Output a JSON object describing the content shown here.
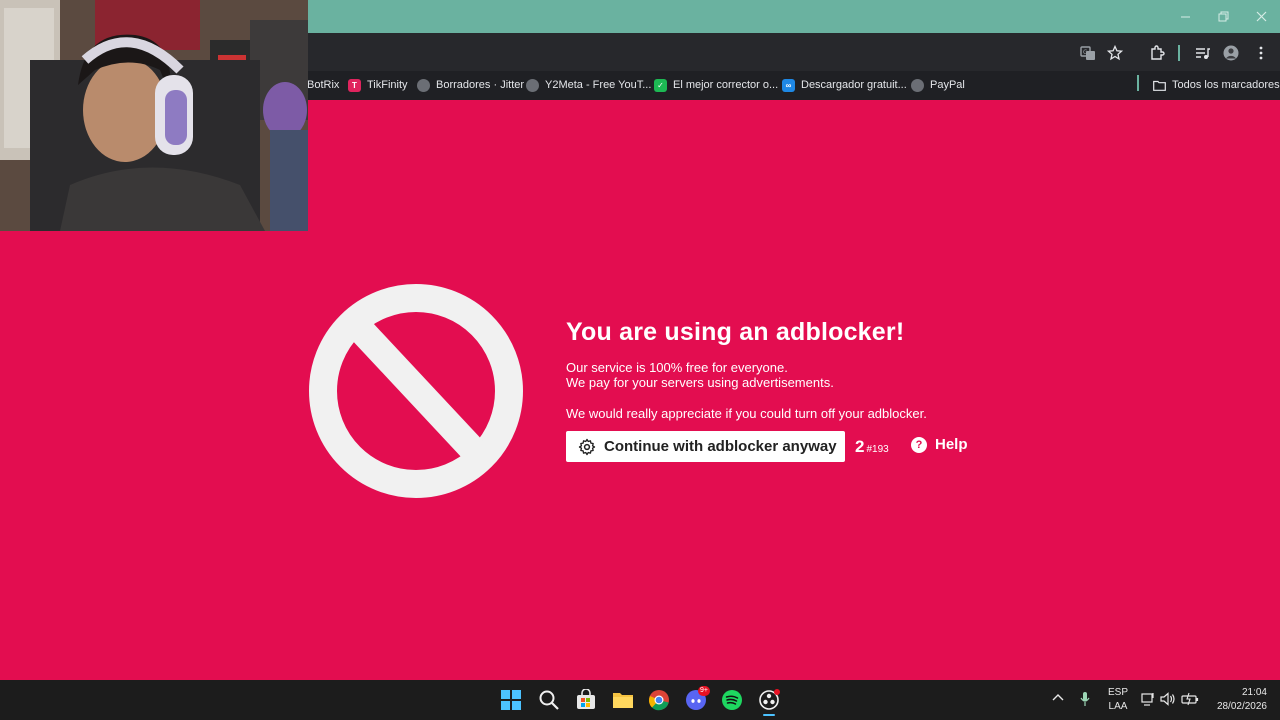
{
  "browser": {
    "bookmarks": [
      {
        "label": "BotRix",
        "favicon_color": "#2a2a2a"
      },
      {
        "label": "TikFinity",
        "favicon_color": "#e0245e"
      },
      {
        "label": "Borradores · Jitter",
        "favicon_color": "#6b6e75"
      },
      {
        "label": "Y2Meta - Free YouT...",
        "favicon_color": "#6b6e75"
      },
      {
        "label": "El mejor corrector o...",
        "favicon_color": "#1db954"
      },
      {
        "label": "Descargador gratuit...",
        "favicon_color": "#1e88e5"
      },
      {
        "label": "PayPal",
        "favicon_color": "#6b6e75"
      }
    ],
    "all_bookmarks_label": "Todos los marcadores"
  },
  "page": {
    "background_color": "#e30d50",
    "headline": "You are using an adblocker!",
    "line1": "Our service is 100% free for everyone.",
    "line2": "We pay for your servers using advertisements.",
    "line3": "We would really appreciate if you could turn off your adblocker.",
    "continue_label": "Continue with adblocker anyway",
    "counter_big": "2",
    "counter_small": "#193",
    "help_label": "Help"
  },
  "taskbar": {
    "apps": [
      "windows-start",
      "search",
      "microsoft-store",
      "file-explorer",
      "chrome",
      "discord",
      "spotify",
      "obs"
    ],
    "discord_badge": "9+",
    "lang_top": "ESP",
    "lang_bottom": "LAA",
    "time": "21:04",
    "date": "28/02/2026"
  }
}
